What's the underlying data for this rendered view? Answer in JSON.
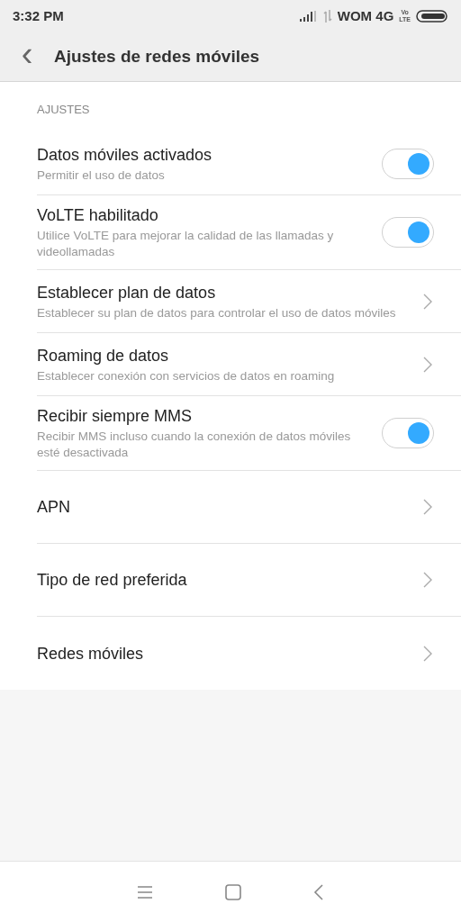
{
  "status_bar": {
    "time": "3:32 PM",
    "carrier": "WOM 4G",
    "volte": [
      "Vo",
      "LTE"
    ]
  },
  "header": {
    "back": "‹",
    "title": "Ajustes de redes móviles"
  },
  "section": {
    "title": "AJUSTES"
  },
  "items": [
    {
      "kind": "toggle",
      "title": "Datos móviles activados",
      "subtitle": "Permitir el uso de datos",
      "on": true
    },
    {
      "kind": "toggle",
      "title": "VoLTE habilitado",
      "subtitle": "Utilice VoLTE para mejorar la calidad de las llamadas y videollamadas",
      "on": true
    },
    {
      "kind": "link",
      "title": "Establecer plan de datos",
      "subtitle": "Establecer su plan de datos para controlar el uso de datos móviles"
    },
    {
      "kind": "link",
      "title": "Roaming de datos",
      "subtitle": "Establecer conexión con servicios de datos en roaming"
    },
    {
      "kind": "toggle",
      "title": "Recibir siempre MMS",
      "subtitle": "Recibir MMS incluso cuando la conexión de datos móviles esté desactivada",
      "on": true
    },
    {
      "kind": "link",
      "title": "APN"
    },
    {
      "kind": "link",
      "title": "Tipo de red preferida"
    },
    {
      "kind": "link",
      "title": "Redes móviles"
    }
  ]
}
